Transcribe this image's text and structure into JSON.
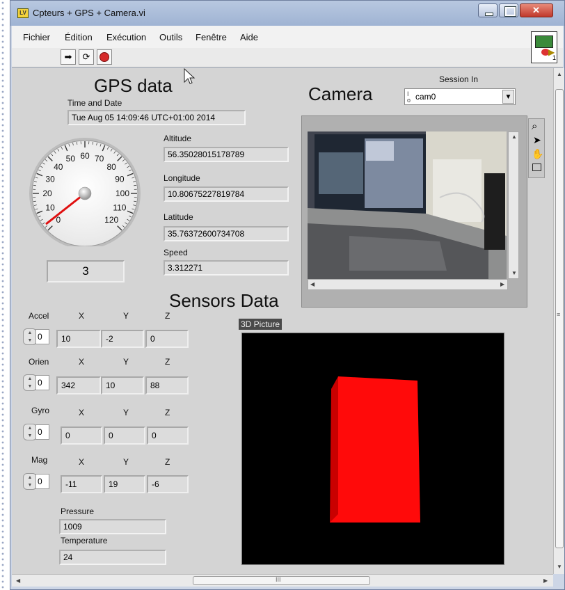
{
  "window": {
    "title": "Cpteurs + GPS + Camera.vi"
  },
  "menu": [
    "Fichier",
    "Édition",
    "Exécution",
    "Outils",
    "Fenêtre",
    "Aide"
  ],
  "gps": {
    "heading": "GPS  data",
    "time_label": "Time and Date",
    "time_value": "Tue Aug 05 14:09:46 UTC+01:00 2014",
    "altitude_label": "Altitude",
    "altitude_value": "56.35028015178789",
    "longitude_label": "Longitude",
    "longitude_value": "10.80675227819784",
    "latitude_label": "Latitude",
    "latitude_value": "35.76372600734708",
    "speed_label": "Speed",
    "speed_value": "3.312271",
    "gauge_value": "3",
    "gauge_ticks": [
      "0",
      "10",
      "20",
      "30",
      "40",
      "50",
      "60",
      "70",
      "80",
      "90",
      "100",
      "110",
      "120"
    ],
    "gauge_needle": 3,
    "gauge_max": 120
  },
  "camera": {
    "heading": "Camera",
    "session_label": "Session In",
    "session_value": "cam0"
  },
  "sensors": {
    "heading": "Sensors Data",
    "picture_label": "3D Picture",
    "x": "X",
    "y": "Y",
    "z": "Z",
    "accel": {
      "label": "Accel",
      "ctrl": "0",
      "x": "10",
      "y": "-2",
      "z": "0"
    },
    "orien": {
      "label": "Orien",
      "ctrl": "0",
      "x": "342",
      "y": "10",
      "z": "88"
    },
    "gyro": {
      "label": "Gyro",
      "ctrl": "0",
      "x": "0",
      "y": "0",
      "z": "0"
    },
    "mag": {
      "label": "Mag",
      "ctrl": "0",
      "x": "-11",
      "y": "19",
      "z": "-6"
    },
    "pressure_label": "Pressure",
    "pressure_value": "1009",
    "temperature_label": "Temperature",
    "temperature_value": "24"
  },
  "scroll": {
    "h_center": "III",
    "v_grip": "≡"
  }
}
